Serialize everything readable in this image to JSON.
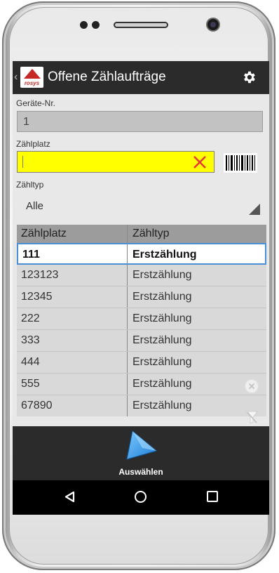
{
  "header": {
    "title": "Offene Zählaufträge",
    "logo_text": "rosys"
  },
  "geraete": {
    "label": "Geräte-Nr.",
    "value": "1"
  },
  "zaehlplatz": {
    "label": "Zählplatz",
    "value": ""
  },
  "zaehltyp": {
    "label": "Zähltyp",
    "selected": "Alle"
  },
  "table": {
    "columns": [
      "Zählplatz",
      "Zähltyp"
    ],
    "rows": [
      [
        "111",
        "Erstzählung"
      ],
      [
        "123123",
        "Erstzählung"
      ],
      [
        "12345",
        "Erstzählung"
      ],
      [
        "222",
        "Erstzählung"
      ],
      [
        "333",
        "Erstzählung"
      ],
      [
        "444",
        "Erstzählung"
      ],
      [
        "555",
        "Erstzählung"
      ],
      [
        "67890",
        "Erstzählung"
      ]
    ]
  },
  "action": {
    "select_label": "Auswählen"
  },
  "colors": {
    "header": "#2b2b2b",
    "input_highlight": "#ffff00",
    "clear_x": "#e53935",
    "selection_border": "#4a90d9",
    "select_arrow": "#2f9be8"
  },
  "icons": [
    "back-chevron-icon",
    "rosys-logo",
    "gear-icon",
    "clear-x-icon",
    "barcode-icon",
    "dropdown-triangle-icon",
    "clear-circle-icon",
    "filter-clear-icon",
    "play-arrow-icon",
    "nav-back-icon",
    "nav-home-icon",
    "nav-recents-icon"
  ]
}
